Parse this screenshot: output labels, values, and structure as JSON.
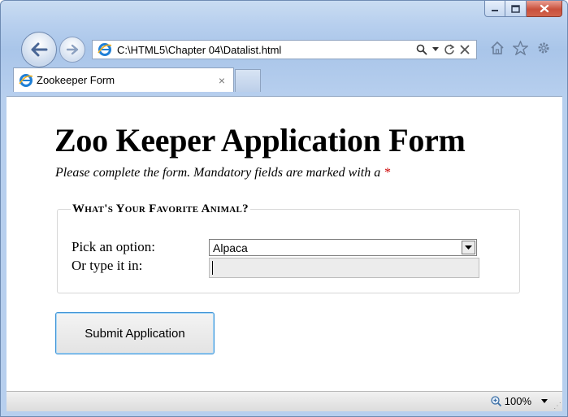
{
  "browser": {
    "address_url": "C:\\HTML5\\Chapter 04\\Datalist.html",
    "tab_title": "Zookeeper Form",
    "tab_close": "×",
    "zoom_level": "100%"
  },
  "page": {
    "heading": "Zoo Keeper Application Form",
    "subtitle": "Please complete the form. Mandatory fields are marked with a",
    "required_marker": "*",
    "fieldset_legend": "What's Your Favorite Animal?",
    "pick_label": "Pick an option:",
    "pick_selected": "Alpaca",
    "type_label": "Or type it in:",
    "type_value": "",
    "submit_label": "Submit Application"
  },
  "colors": {
    "required_star": "#cc0000",
    "submit_border": "#3d93d6"
  },
  "icons": [
    "back-arrow-icon",
    "forward-arrow-icon",
    "ie-page-icon",
    "search-icon",
    "dropdown-arrow-icon",
    "refresh-icon",
    "stop-icon",
    "home-icon",
    "favorites-star-icon",
    "tools-gear-icon",
    "zoom-icon",
    "minimize-icon",
    "maximize-icon",
    "close-icon"
  ]
}
